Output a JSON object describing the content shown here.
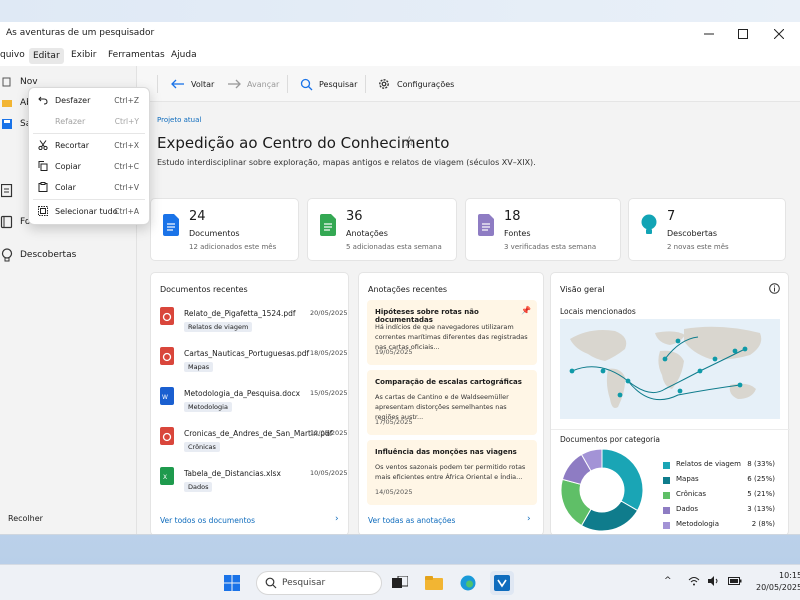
{
  "app": {
    "title": "As aventuras de um pesquisador"
  },
  "menubar": {
    "items": [
      "quivo",
      "Editar",
      "Exibir",
      "Ferramentas",
      "Ajuda"
    ]
  },
  "sidebar": {
    "top_items": [
      "Nov",
      "Abri",
      "Salv"
    ],
    "items": [
      "Fontes",
      "Descobertas"
    ],
    "collapse_label": "Recolher"
  },
  "edit_menu": {
    "items": [
      {
        "label": "Desfazer",
        "shortcut": "Ctrl+Z",
        "icon": "undo-icon",
        "enabled": true
      },
      {
        "label": "Refazer",
        "shortcut": "Ctrl+Y",
        "icon": "redo-icon",
        "enabled": false
      },
      {
        "label": "Recortar",
        "shortcut": "Ctrl+X",
        "icon": "cut-icon",
        "enabled": true
      },
      {
        "label": "Copiar",
        "shortcut": "Ctrl+C",
        "icon": "copy-icon",
        "enabled": true
      },
      {
        "label": "Colar",
        "shortcut": "Ctrl+V",
        "icon": "paste-icon",
        "enabled": true
      },
      {
        "label": "Selecionar tudo",
        "shortcut": "Ctrl+A",
        "icon": "select-all-icon",
        "enabled": true
      }
    ]
  },
  "toolbar": {
    "back_label": "Voltar",
    "forward_label": "Avançar",
    "search_label": "Pesquisar",
    "settings_label": "Configurações"
  },
  "main": {
    "breadcrumb": "Projeto atual",
    "title": "Expedição ao Centro do Conhecimento",
    "subtitle": "Estudo interdisciplinar sobre exploração, mapas antigos e relatos de viagem (séculos XV–XIX).",
    "stats": [
      {
        "value": "24",
        "label": "Documentos",
        "sub": "12 adicionados este mês",
        "color": "#1a73e8"
      },
      {
        "value": "36",
        "label": "Anotações",
        "sub": "5 adicionadas esta semana",
        "color": "#34a853"
      },
      {
        "value": "18",
        "label": "Fontes",
        "sub": "3 verificadas esta semana",
        "color": "#8e7cc3"
      },
      {
        "value": "7",
        "label": "Descobertas",
        "sub": "2 novas este mês",
        "color": "#12a4b5"
      }
    ]
  },
  "documents": {
    "title": "Documentos recentes",
    "items": [
      {
        "name": "Relato_de_Pigafetta_1524.pdf",
        "date": "20/05/2025",
        "tag": "Relatos de viagem",
        "type": "pdf"
      },
      {
        "name": "Cartas_Nauticas_Portuguesas.pdf",
        "date": "18/05/2025",
        "tag": "Mapas",
        "type": "pdf"
      },
      {
        "name": "Metodologia_da_Pesquisa.docx",
        "date": "15/05/2025",
        "tag": "Metodologia",
        "type": "docx"
      },
      {
        "name": "Cronicas_de_Andres_de_San_Martin.pdf",
        "date": "12/05/2025",
        "tag": "Crônicas",
        "type": "pdf"
      },
      {
        "name": "Tabela_de_Distancias.xlsx",
        "date": "10/05/2025",
        "tag": "Dados",
        "type": "xlsx"
      }
    ],
    "footer_link": "Ver todos os documentos"
  },
  "notes": {
    "title": "Anotações recentes",
    "items": [
      {
        "title": "Hipóteses sobre rotas não documentadas",
        "body": "Há indícios de que navegadores utilizaram correntes marítimas diferentes das registradas nas cartas oficiais...",
        "date": "19/05/2025",
        "pinned": true
      },
      {
        "title": "Comparação de escalas cartográficas",
        "body": "As cartas de Cantino e de Waldseemüller apresentam distorções semelhantes nas regiões austr...",
        "date": "17/05/2025",
        "pinned": false
      },
      {
        "title": "Influência das monções nas viagens",
        "body": "Os ventos sazonais podem ter permitido rotas mais eficientes entre África Oriental e Índia...",
        "date": "14/05/2025",
        "pinned": false
      }
    ],
    "footer_link": "Ver todas as anotações"
  },
  "overview": {
    "title": "Visão geral",
    "map_title": "Locais mencionados",
    "chart_title": "Documentos por categoria"
  },
  "chart_data": {
    "type": "pie",
    "title": "Documentos por categoria",
    "categories": [
      "Relatos de viagem",
      "Mapas",
      "Crônicas",
      "Dados",
      "Metodologia"
    ],
    "values": [
      8,
      6,
      5,
      3,
      2
    ],
    "labels": [
      "8 (33%)",
      "6 (25%)",
      "5 (21%)",
      "3 (13%)",
      "2 (8%)"
    ],
    "colors": [
      "#1aa5b5",
      "#0f7c8c",
      "#5fbf67",
      "#8e7cc3",
      "#a393d6"
    ],
    "donut": true
  },
  "taskbar": {
    "search_placeholder": "Pesquisar",
    "time": "10:15",
    "date": "20/05/2025"
  }
}
